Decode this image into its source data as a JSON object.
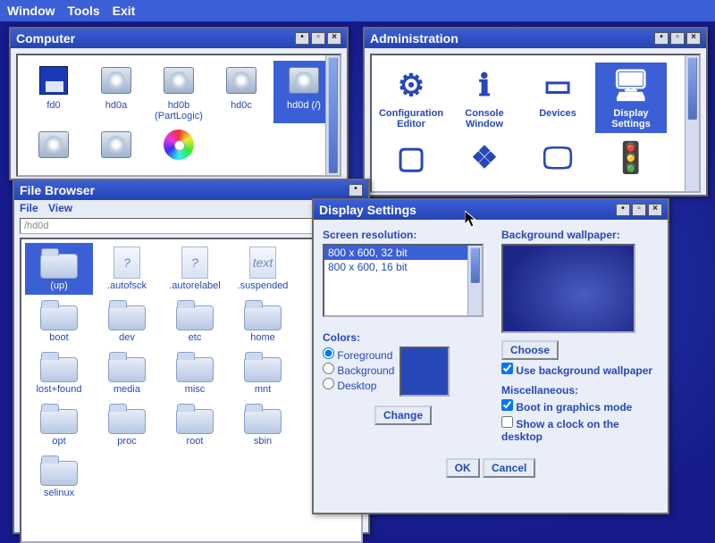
{
  "menubar": {
    "items": [
      "Window",
      "Tools",
      "Exit"
    ]
  },
  "computer_window": {
    "title": "Computer",
    "drives": [
      {
        "label": "fd0",
        "kind": "floppy"
      },
      {
        "label": "hd0a",
        "kind": "disk"
      },
      {
        "label": "hd0b (PartLogic)",
        "kind": "disk"
      },
      {
        "label": "hd0c",
        "kind": "disk"
      },
      {
        "label": "hd0d (/)",
        "kind": "disk",
        "selected": true
      },
      {
        "label": "",
        "kind": "disk"
      },
      {
        "label": "",
        "kind": "disk"
      },
      {
        "label": "",
        "kind": "cd"
      }
    ]
  },
  "admin_window": {
    "title": "Administration",
    "items_row1": [
      {
        "label": "Configuration Editor",
        "glyph": "⚙"
      },
      {
        "label": "Console Window",
        "glyph": "ℹ"
      },
      {
        "label": "Devices",
        "glyph": "▭"
      },
      {
        "label": "Display Settings",
        "glyph": "🖥",
        "selected": true
      }
    ],
    "items_row2": [
      {
        "glyph": "▢"
      },
      {
        "glyph": "❖"
      },
      {
        "glyph": "🖵"
      },
      {
        "glyph": "🚦"
      }
    ]
  },
  "file_browser": {
    "title": "File Browser",
    "menus": [
      "File",
      "View"
    ],
    "path": "/hd0d",
    "items": [
      {
        "label": "(up)",
        "kind": "folder",
        "selected": true
      },
      {
        "label": ".autofsck",
        "kind": "file",
        "glyph": "?"
      },
      {
        "label": ".autorelabel",
        "kind": "file",
        "glyph": "?"
      },
      {
        "label": ".suspended",
        "kind": "file",
        "glyph": "text"
      },
      {
        "label": "boot",
        "kind": "folder"
      },
      {
        "label": "dev",
        "kind": "folder"
      },
      {
        "label": "etc",
        "kind": "folder"
      },
      {
        "label": "home",
        "kind": "folder"
      },
      {
        "label": "lost+found",
        "kind": "folder"
      },
      {
        "label": "media",
        "kind": "folder"
      },
      {
        "label": "misc",
        "kind": "folder"
      },
      {
        "label": "mnt",
        "kind": "folder"
      },
      {
        "label": "opt",
        "kind": "folder"
      },
      {
        "label": "proc",
        "kind": "folder"
      },
      {
        "label": "root",
        "kind": "folder"
      },
      {
        "label": "sbin",
        "kind": "folder"
      },
      {
        "label": "selinux",
        "kind": "folder"
      }
    ]
  },
  "display_settings": {
    "title": "Display Settings",
    "res_label": "Screen resolution:",
    "resolutions": [
      {
        "text": "800 x 600, 32 bit",
        "selected": true
      },
      {
        "text": "800 x 600, 16 bit"
      }
    ],
    "colors_label": "Colors:",
    "color_options": [
      "Foreground",
      "Background",
      "Desktop"
    ],
    "change_btn": "Change",
    "wallpaper_label": "Background wallpaper:",
    "choose_btn": "Choose",
    "use_wallpaper": "Use background wallpaper",
    "misc_label": "Miscellaneous:",
    "boot_graphics": "Boot in graphics mode",
    "show_clock": "Show a clock on the desktop",
    "ok_btn": "OK",
    "cancel_btn": "Cancel"
  }
}
